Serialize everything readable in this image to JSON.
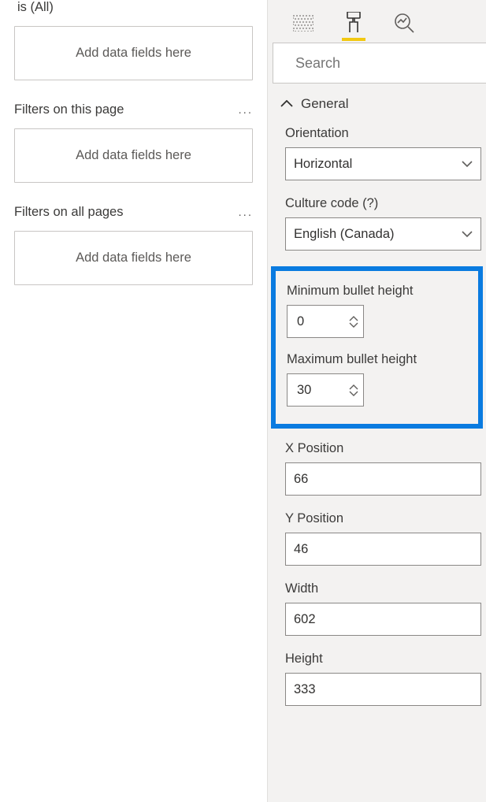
{
  "filters": {
    "is_all": "is (All)",
    "visual_placeholder": "Add data fields here",
    "this_page_label": "Filters on this page",
    "page_placeholder": "Add data fields here",
    "all_pages_label": "Filters on all pages",
    "all_pages_placeholder": "Add data fields here"
  },
  "search": {
    "placeholder": "Search"
  },
  "section": {
    "general": "General"
  },
  "props": {
    "orientation": {
      "label": "Orientation",
      "value": "Horizontal"
    },
    "culture": {
      "label": "Culture code (?)",
      "value": "English (Canada)"
    },
    "min_bullet": {
      "label": "Minimum bullet height",
      "value": "0"
    },
    "max_bullet": {
      "label": "Maximum bullet height",
      "value": "30"
    },
    "x_pos": {
      "label": "X Position",
      "value": "66"
    },
    "y_pos": {
      "label": "Y Position",
      "value": "46"
    },
    "width": {
      "label": "Width",
      "value": "602"
    },
    "height": {
      "label": "Height",
      "value": "333"
    }
  }
}
